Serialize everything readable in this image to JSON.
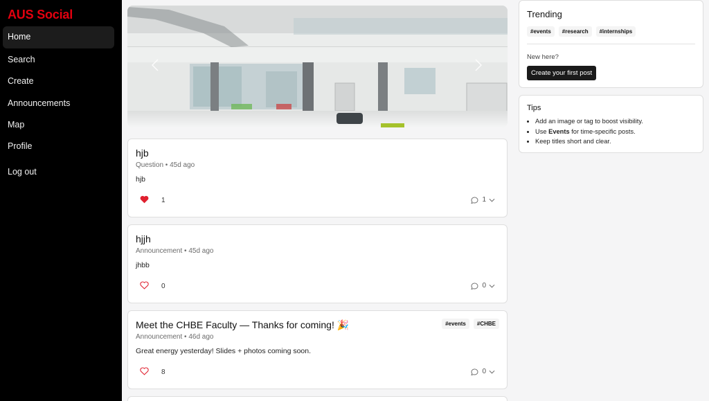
{
  "brand": "AUS Social",
  "nav": {
    "home": "Home",
    "search": "Search",
    "create": "Create",
    "announcements": "Announcements",
    "map": "Map",
    "profile": "Profile",
    "logout": "Log out"
  },
  "posts": [
    {
      "title": "hjb",
      "meta": "Question • 45d ago",
      "body": "hjb",
      "likes": "1",
      "liked": true,
      "comments": "1",
      "tags": []
    },
    {
      "title": "hjjh",
      "meta": "Announcement • 45d ago",
      "body": "jhbb",
      "likes": "0",
      "liked": false,
      "comments": "0",
      "tags": []
    },
    {
      "title": "Meet the CHBE Faculty — Thanks for coming! 🎉",
      "meta": "Announcement • 46d ago",
      "body": "Great energy yesterday! Slides + photos coming soon.",
      "likes": "8",
      "liked": false,
      "comments": "0",
      "tags": [
        "#events",
        "#CHBE"
      ]
    }
  ],
  "trending": {
    "title": "Trending",
    "tags": [
      "#events",
      "#research",
      "#internships"
    ],
    "new_here": "New here?",
    "cta": "Create your first post"
  },
  "tips": {
    "title": "Tips",
    "item1": "Add an image or tag to boost visibility.",
    "item2_prefix": "Use ",
    "item2_bold": "Events",
    "item2_suffix": " for time-specific posts.",
    "item3": "Keep titles short and clear."
  },
  "colors": {
    "brand": "#e3000f",
    "like_active": "#e0202f",
    "sidebar_bg": "#000000"
  },
  "icons": {
    "like": "heart-icon",
    "comment": "comment-bubble-icon",
    "expand": "chevron-down-icon",
    "prev": "chevron-left-icon",
    "next": "chevron-right-icon"
  }
}
